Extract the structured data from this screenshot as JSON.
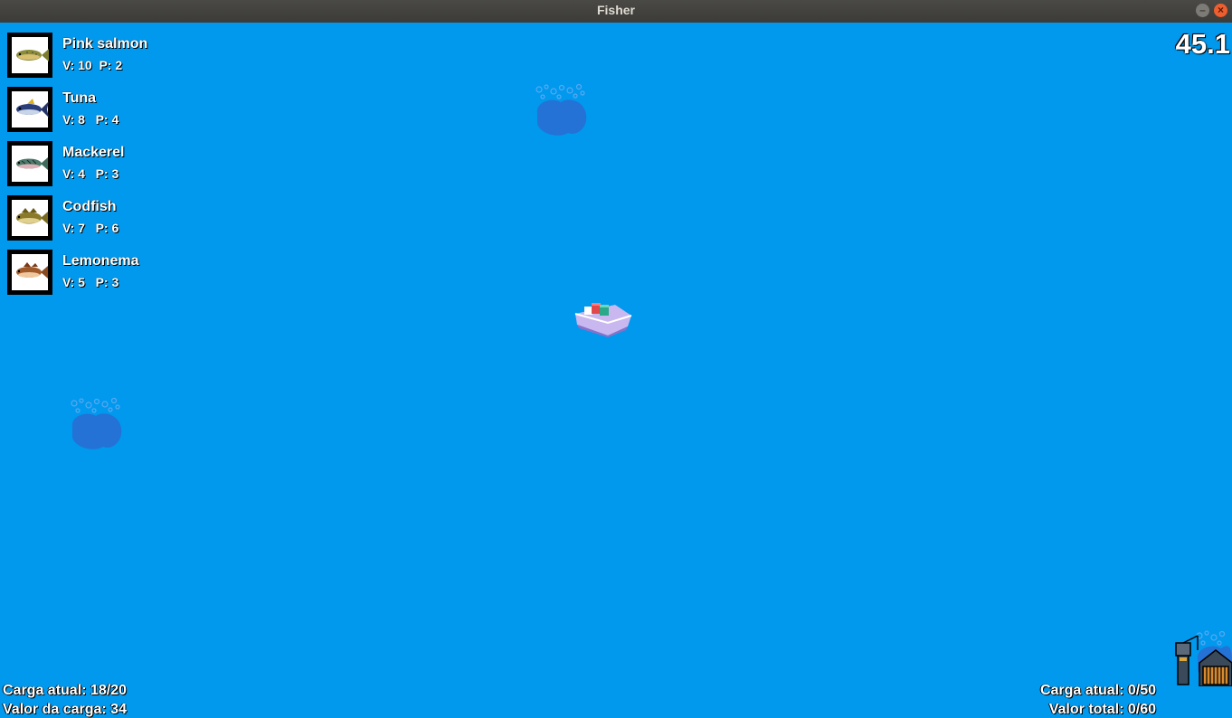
{
  "window": {
    "title": "Fisher",
    "minimize_glyph": "–",
    "close_glyph": "×"
  },
  "fish": [
    {
      "name": "Pink salmon",
      "stats": "V: 10  P: 2",
      "icon": "pink-salmon-icon",
      "color": "#8a8c3a"
    },
    {
      "name": "Tuna",
      "stats": "V: 8   P: 4",
      "icon": "tuna-icon",
      "color": "#2a3e7a"
    },
    {
      "name": "Mackerel",
      "stats": "V: 4   P: 3",
      "icon": "mackerel-icon",
      "color": "#4d7a6a"
    },
    {
      "name": "Codfish",
      "stats": "V: 7   P: 6",
      "icon": "codfish-icon",
      "color": "#8a7a2a"
    },
    {
      "name": "Lemonema",
      "stats": "V: 5   P: 3",
      "icon": "lemonema-icon",
      "color": "#a05a2a"
    }
  ],
  "timer": "45.1",
  "boat_hud": {
    "cargo": "Carga atual: 18/20",
    "value": "Valor da carga: 34"
  },
  "port_hud": {
    "cargo": "Carga atual: 0/50",
    "value": "Valor total: 0/60"
  },
  "colors": {
    "sea": "#0099ee",
    "fishing_spot": "#2a6bd1",
    "boat_hull": "#c9b8f0"
  }
}
